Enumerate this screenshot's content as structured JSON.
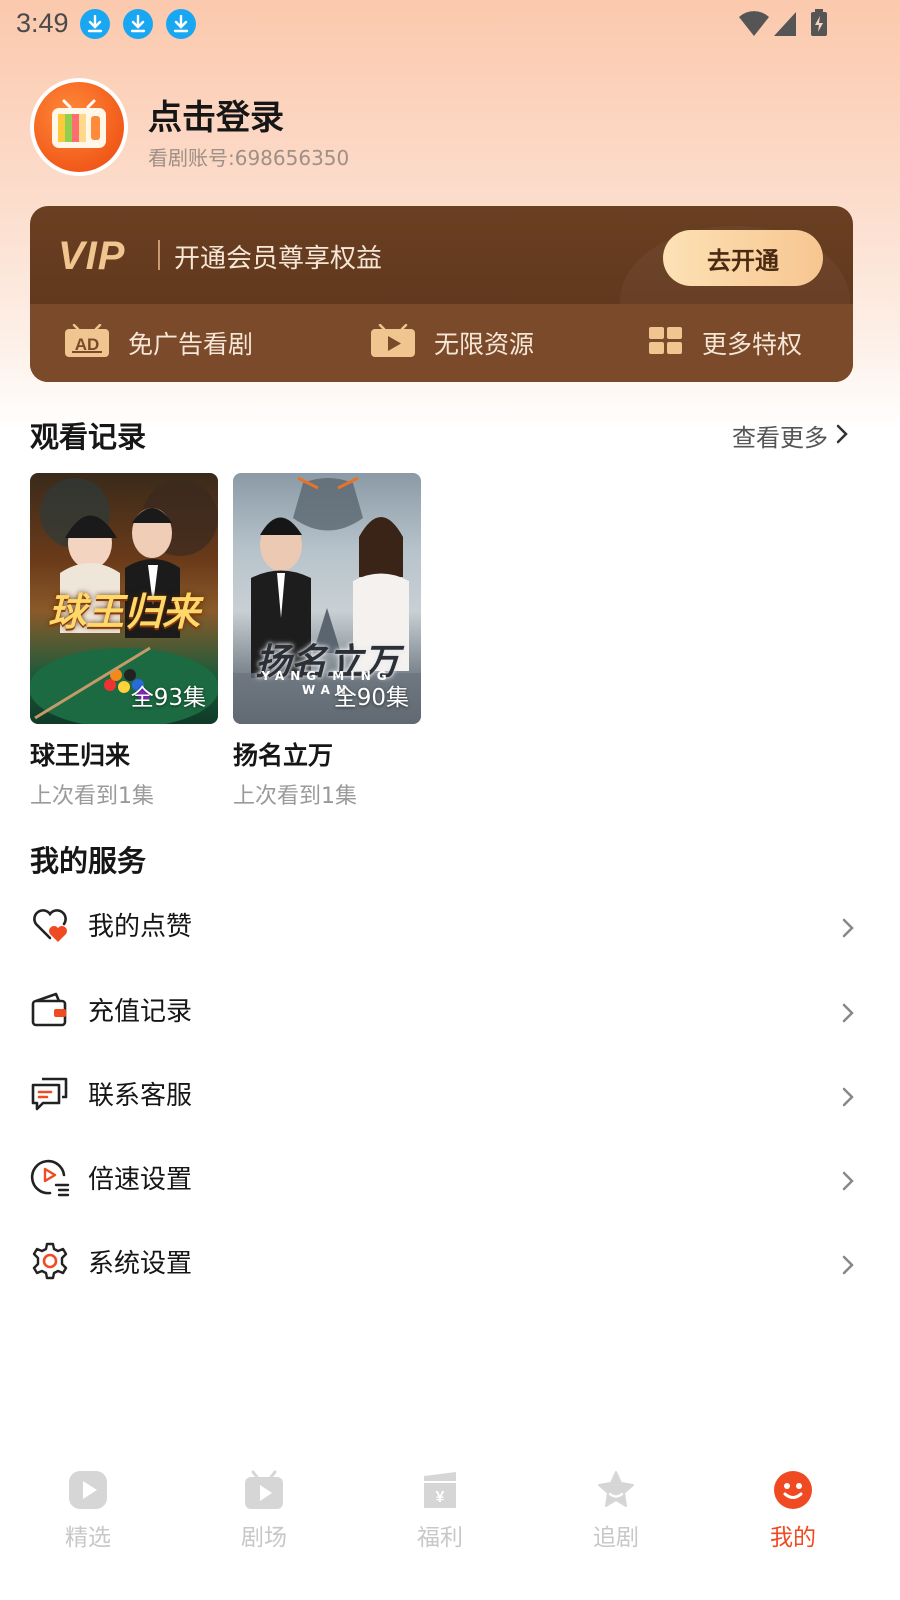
{
  "status_bar": {
    "time": "3:49",
    "icons": [
      "download-icon",
      "download-icon",
      "download-icon",
      "wifi-icon",
      "signal-icon",
      "battery-charging-icon"
    ]
  },
  "profile": {
    "title": "点击登录",
    "account": "看剧账号:698656350",
    "avatar_icon": "tv-icon"
  },
  "vip": {
    "logo": "VIP",
    "slogan": "开通会员尊享权益",
    "button": "去开通",
    "perks": [
      {
        "icon": "ad-icon",
        "label": "免广告看剧"
      },
      {
        "icon": "play-tv-icon",
        "label": "无限资源"
      },
      {
        "icon": "grid-icon",
        "label": "更多特权"
      }
    ]
  },
  "history": {
    "title": "观看记录",
    "more": "查看更多",
    "items": [
      {
        "name": "球王归来",
        "progress": "上次看到1集",
        "episodes": "全93集",
        "poster_text": "球王归来"
      },
      {
        "name": "扬名立万",
        "progress": "上次看到1集",
        "episodes": "全90集",
        "poster_text": "扬名立万",
        "poster_subtext": "YANG MING WAN"
      }
    ]
  },
  "services": {
    "title": "我的服务",
    "items": [
      {
        "icon": "heart-like-icon",
        "label": "我的点赞"
      },
      {
        "icon": "wallet-icon",
        "label": "充值记录"
      },
      {
        "icon": "chat-support-icon",
        "label": "联系客服"
      },
      {
        "icon": "playback-speed-icon",
        "label": "倍速设置"
      },
      {
        "icon": "gear-icon",
        "label": "系统设置"
      }
    ]
  },
  "nav": {
    "items": [
      {
        "icon": "play-icon",
        "label": "精选",
        "active": false
      },
      {
        "icon": "tv-icon",
        "label": "剧场",
        "active": false
      },
      {
        "icon": "gift-icon",
        "label": "福利",
        "active": false
      },
      {
        "icon": "star-icon",
        "label": "追剧",
        "active": false
      },
      {
        "icon": "smile-icon",
        "label": "我的",
        "active": true
      }
    ]
  },
  "colors": {
    "accent": "#f04a23",
    "vip_brown": "#6a3f22",
    "vip_gold": "#f0c590"
  }
}
